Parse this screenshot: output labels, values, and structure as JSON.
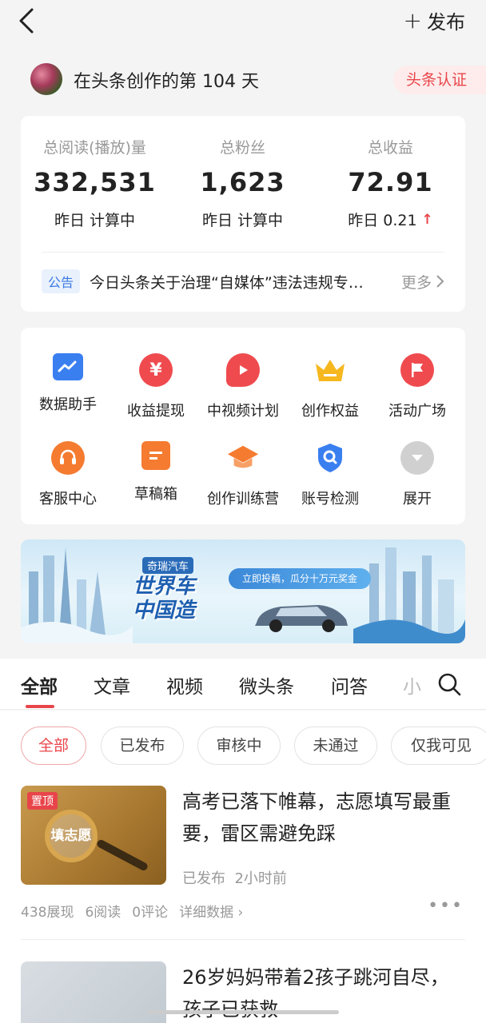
{
  "header": {
    "publish_label": "发布"
  },
  "profile": {
    "text": "在头条创作的第 104 天",
    "badge": "头条认证"
  },
  "stats": [
    {
      "label": "总阅读(播放)量",
      "value": "332,531",
      "sub": "昨日 计算中"
    },
    {
      "label": "总粉丝",
      "value": "1,623",
      "sub": "昨日 计算中"
    },
    {
      "label": "总收益",
      "value": "72.91",
      "sub": "昨日 0.21"
    }
  ],
  "notice": {
    "tag": "公告",
    "text": "今日头条关于治理“自媒体”违法违规专…",
    "more": "更多"
  },
  "tools": [
    {
      "label": "数据助手",
      "icon": "chart-icon",
      "color": "#3a7ff0"
    },
    {
      "label": "收益提现",
      "icon": "yuan-icon",
      "color": "#ef4b4f"
    },
    {
      "label": "中视频计划",
      "icon": "video-icon",
      "color": "#ef4b4f"
    },
    {
      "label": "创作权益",
      "icon": "crown-icon",
      "color": "#f6b71f"
    },
    {
      "label": "活动广场",
      "icon": "flag-icon",
      "color": "#ef4b4f"
    },
    {
      "label": "客服中心",
      "icon": "headset-icon",
      "color": "#f57b30"
    },
    {
      "label": "草稿箱",
      "icon": "draft-icon",
      "color": "#f57b30"
    },
    {
      "label": "创作训练营",
      "icon": "graduation-cap-icon",
      "color": "#f57b30"
    },
    {
      "label": "账号检测",
      "icon": "shield-search-icon",
      "color": "#3a7ff0"
    },
    {
      "label": "展开",
      "icon": "chevron-down-icon",
      "color": "#bdbdbd"
    }
  ],
  "banner": {
    "brand": "奇瑞汽车",
    "title_line1": "世界车",
    "title_line2": "中国造",
    "cta": "立即投稿，瓜分十万元奖金"
  },
  "tabs": [
    "全部",
    "文章",
    "视频",
    "微头条",
    "问答",
    "小"
  ],
  "filters": [
    "全部",
    "已发布",
    "审核中",
    "未通过",
    "仅我可见"
  ],
  "articles": [
    {
      "pinned": "置顶",
      "thumb_text": "填志愿",
      "title": "高考已落下帷幕，志愿填写最重要，雷区需避免踩",
      "status": "已发布",
      "time": "2小时前",
      "impressions": "438展现",
      "reads": "6阅读",
      "comments": "0评论",
      "details": "详细数据"
    },
    {
      "title": "26岁妈妈带着2孩子跳河自尽，孩子已获救"
    }
  ],
  "colors": {
    "accent": "#e8454b",
    "blue": "#3c7ae4"
  }
}
